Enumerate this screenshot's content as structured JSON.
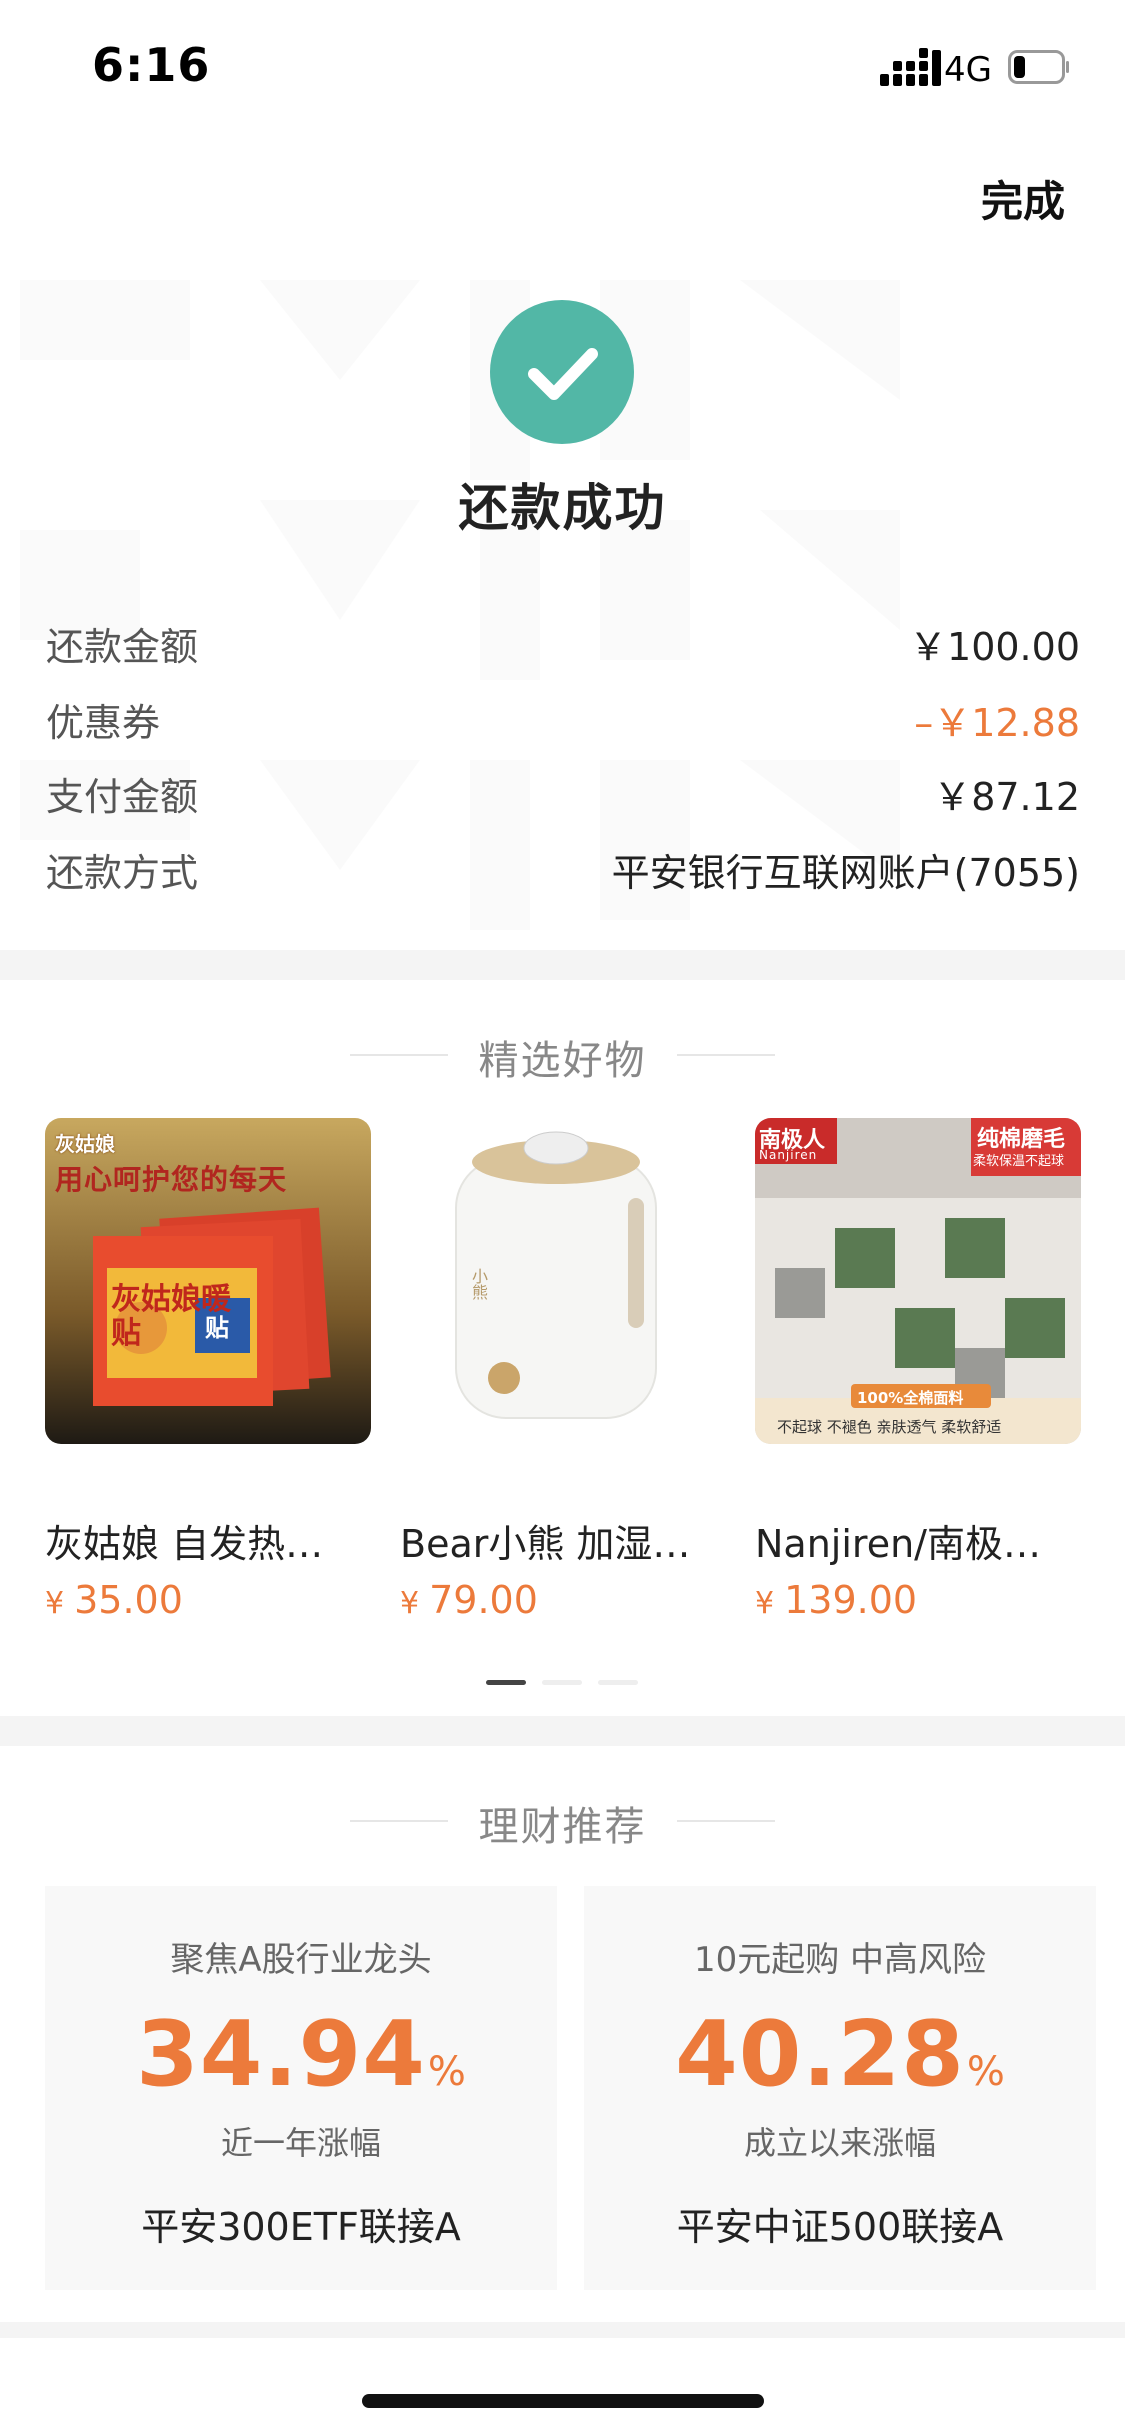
{
  "status_bar": {
    "time": "6:16",
    "network": "4G",
    "battery_level": 0.25
  },
  "header": {
    "done_label": "完成"
  },
  "success": {
    "title": "还款成功",
    "details": [
      {
        "label": "还款金额",
        "value": "￥100.00"
      },
      {
        "label": "优惠券",
        "value": "–￥12.88"
      },
      {
        "label": "支付金额",
        "value": "￥87.12"
      },
      {
        "label": "还款方式",
        "value": "平安银行互联网账户(7055)"
      }
    ]
  },
  "goods": {
    "section_title": "精选好物",
    "items": [
      {
        "name": "灰姑娘 自发热…",
        "currency": "¥",
        "price": "35.00",
        "image_text": {
          "brand": "灰姑娘",
          "slogan": "用心呵护您的每天",
          "product": "灰姑娘暖贴",
          "tag": "贴"
        }
      },
      {
        "name": "Bear小熊 加湿…",
        "currency": "¥",
        "price": "79.00",
        "image_text": {
          "brand": "小熊"
        }
      },
      {
        "name": "Nanjiren/南极…",
        "currency": "¥",
        "price": "139.00",
        "image_text": {
          "brand": "南极人",
          "brand_en": "Nanjiren",
          "badge": "纯棉磨毛",
          "badge_sub": "柔软保温不起球",
          "fabric": "100%全棉面料",
          "features": "不起球 不褪色 亲肤透气 柔软舒适"
        }
      }
    ],
    "pager": {
      "count": 3,
      "active": 0
    }
  },
  "finance": {
    "section_title": "理财推荐",
    "funds": [
      {
        "desc": "聚焦A股行业龙头",
        "rate": "34.94",
        "unit": "%",
        "rate_label": "近一年涨幅",
        "name": "平安300ETF联接A"
      },
      {
        "desc": "10元起购 中高风险",
        "rate": "40.28",
        "unit": "%",
        "rate_label": "成立以来涨幅",
        "name": "平安中证500联接A"
      }
    ]
  },
  "colors": {
    "accent": "#ec7a3b",
    "success": "#52b7a6",
    "divider": "#f4f4f4"
  }
}
